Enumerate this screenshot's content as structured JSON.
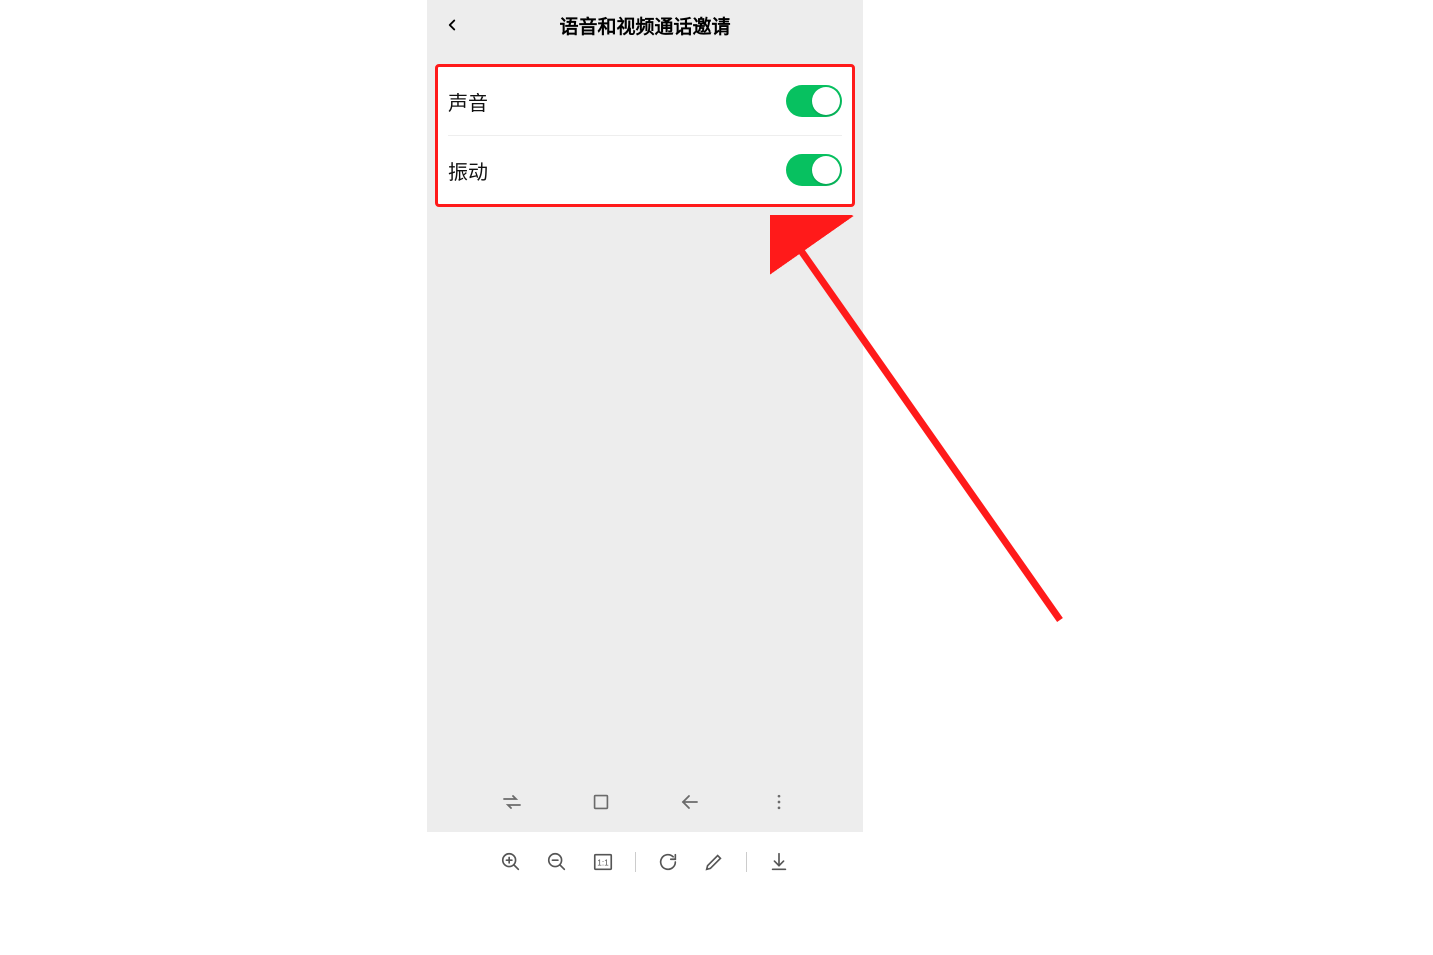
{
  "header": {
    "title": "语音和视频通话邀请"
  },
  "settings": {
    "sound": {
      "label": "声音",
      "on": true
    },
    "vibrate": {
      "label": "振动",
      "on": true
    }
  },
  "icons": {
    "back": "chevron-left",
    "nav": [
      "swap",
      "recent",
      "back",
      "more"
    ],
    "toolbar": [
      "zoom-in",
      "zoom-out",
      "actual-size",
      "rotate",
      "edit",
      "download"
    ]
  },
  "annotation": {
    "highlight_color": "#ff1a1a"
  }
}
